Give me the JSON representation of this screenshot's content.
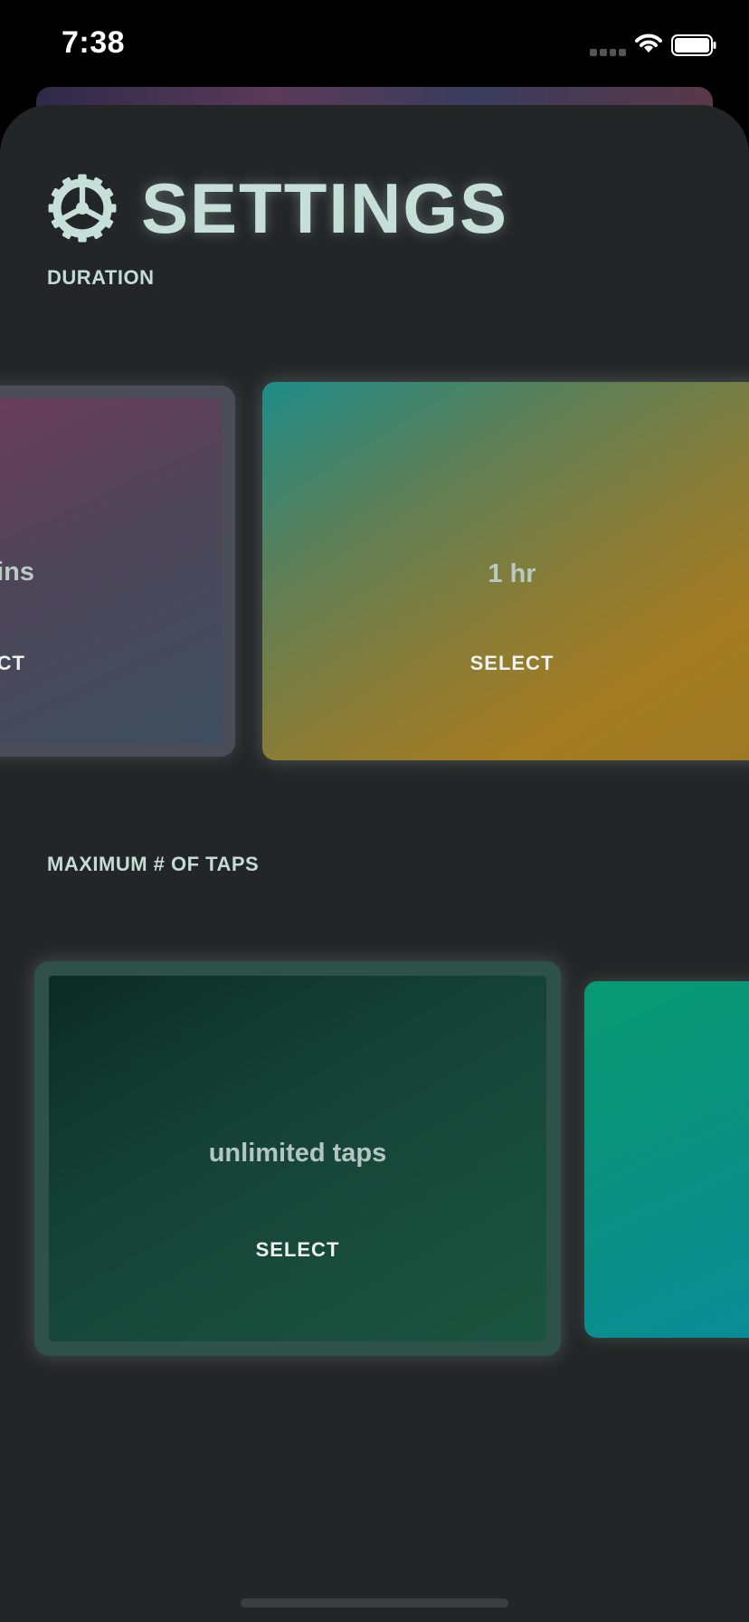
{
  "status_bar": {
    "time": "7:38"
  },
  "header": {
    "title": "SETTINGS"
  },
  "duration": {
    "label": "DURATION",
    "cards": [
      {
        "value_partial": "hins",
        "select_partial": "CT"
      },
      {
        "value": "1 hr",
        "select": "SELECT"
      }
    ]
  },
  "taps": {
    "label": "MAXIMUM # OF TAPS",
    "cards": [
      {
        "value": "unlimited taps",
        "select": "SELECT"
      }
    ]
  },
  "colors": {
    "background": "#222626",
    "accent_text": "#c6e0d8",
    "status_bar": "#000000"
  },
  "icons": {
    "title": "gear-icon",
    "wifi": "wifi-icon",
    "battery": "battery-icon"
  }
}
